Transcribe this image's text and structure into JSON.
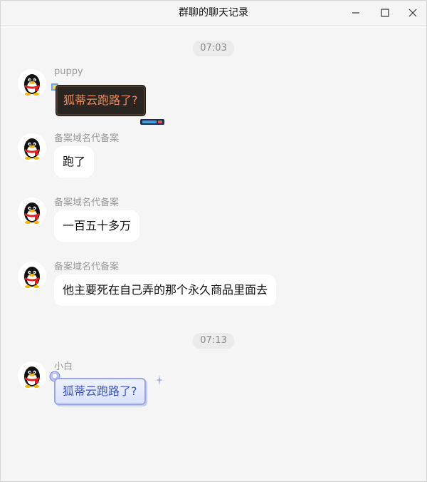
{
  "window": {
    "title": "群聊的聊天记录",
    "controls": [
      "minimize-icon",
      "maximize-icon",
      "close-icon"
    ]
  },
  "timestamps": [
    "07:03",
    "07:13"
  ],
  "messages": [
    {
      "sender": "puppy",
      "text": "狐蒂云跑路了?",
      "style": "dark-bubble"
    },
    {
      "sender": "备案域名代备案",
      "text": "跑了",
      "style": "default"
    },
    {
      "sender": "备案域名代备案",
      "text": "一百五十多万",
      "style": "default"
    },
    {
      "sender": "备案域名代备案",
      "text": "他主要死在自己弄的那个永久商品里面去",
      "style": "default"
    },
    {
      "sender": "小白",
      "text": "狐蒂云跑路了?",
      "style": "blue-bubble"
    }
  ],
  "colors": {
    "background": "#f5f5f5",
    "bubble": "#ffffff",
    "dark_bubble_text": "#f08a5d",
    "blue_bubble_text": "#3b54b5"
  }
}
